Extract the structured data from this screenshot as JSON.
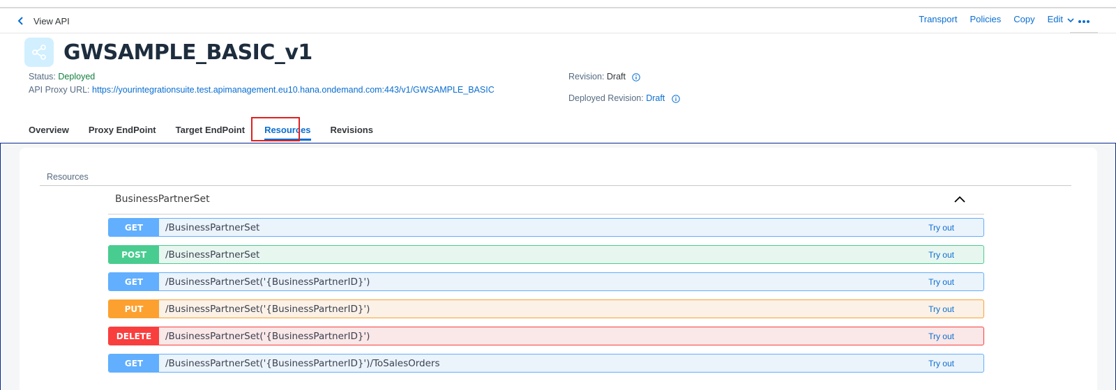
{
  "nav": {
    "back_label": "View API"
  },
  "actions": [
    "Transport",
    "Policies",
    "Copy",
    "Edit"
  ],
  "header": {
    "title": "GWSAMPLE_BASIC_v1",
    "status_label": "Status:",
    "status_value": "Deployed",
    "url_label": "API Proxy URL:",
    "url_value": "https://yourintegrationsuite.test.apimanagement.eu10.hana.ondemand.com:443/v1/GWSAMPLE_BASIC",
    "revision_label": "Revision:",
    "revision_value": "Draft",
    "deployed_revision_label": "Deployed Revision:",
    "deployed_revision_value": "Draft"
  },
  "tabs": [
    "Overview",
    "Proxy EndPoint",
    "Target EndPoint",
    "Resources",
    "Revisions"
  ],
  "active_tab": "Resources",
  "resources": {
    "section_label": "Resources",
    "group_title": "BusinessPartnerSet",
    "try_label": "Try out",
    "operations": [
      {
        "method": "GET",
        "path": "/BusinessPartnerSet"
      },
      {
        "method": "POST",
        "path": "/BusinessPartnerSet"
      },
      {
        "method": "GET",
        "path": "/BusinessPartnerSet('{BusinessPartnerID}')"
      },
      {
        "method": "PUT",
        "path": "/BusinessPartnerSet('{BusinessPartnerID}')"
      },
      {
        "method": "DELETE",
        "path": "/BusinessPartnerSet('{BusinessPartnerID}')"
      },
      {
        "method": "GET",
        "path": "/BusinessPartnerSet('{BusinessPartnerID}')/ToSalesOrders"
      }
    ]
  },
  "colors": {
    "link": "#0a6ed1",
    "status_ok": "#107e3e",
    "get": "#61affe",
    "post": "#49cc90",
    "put": "#fca130",
    "delete": "#f93e3e"
  },
  "icons": {
    "back": "chevron-left-icon",
    "api": "share-icon",
    "edit": "chevron-down-icon",
    "more": "overflow-icon",
    "info": "info-icon",
    "collapse": "chevron-up-icon"
  }
}
